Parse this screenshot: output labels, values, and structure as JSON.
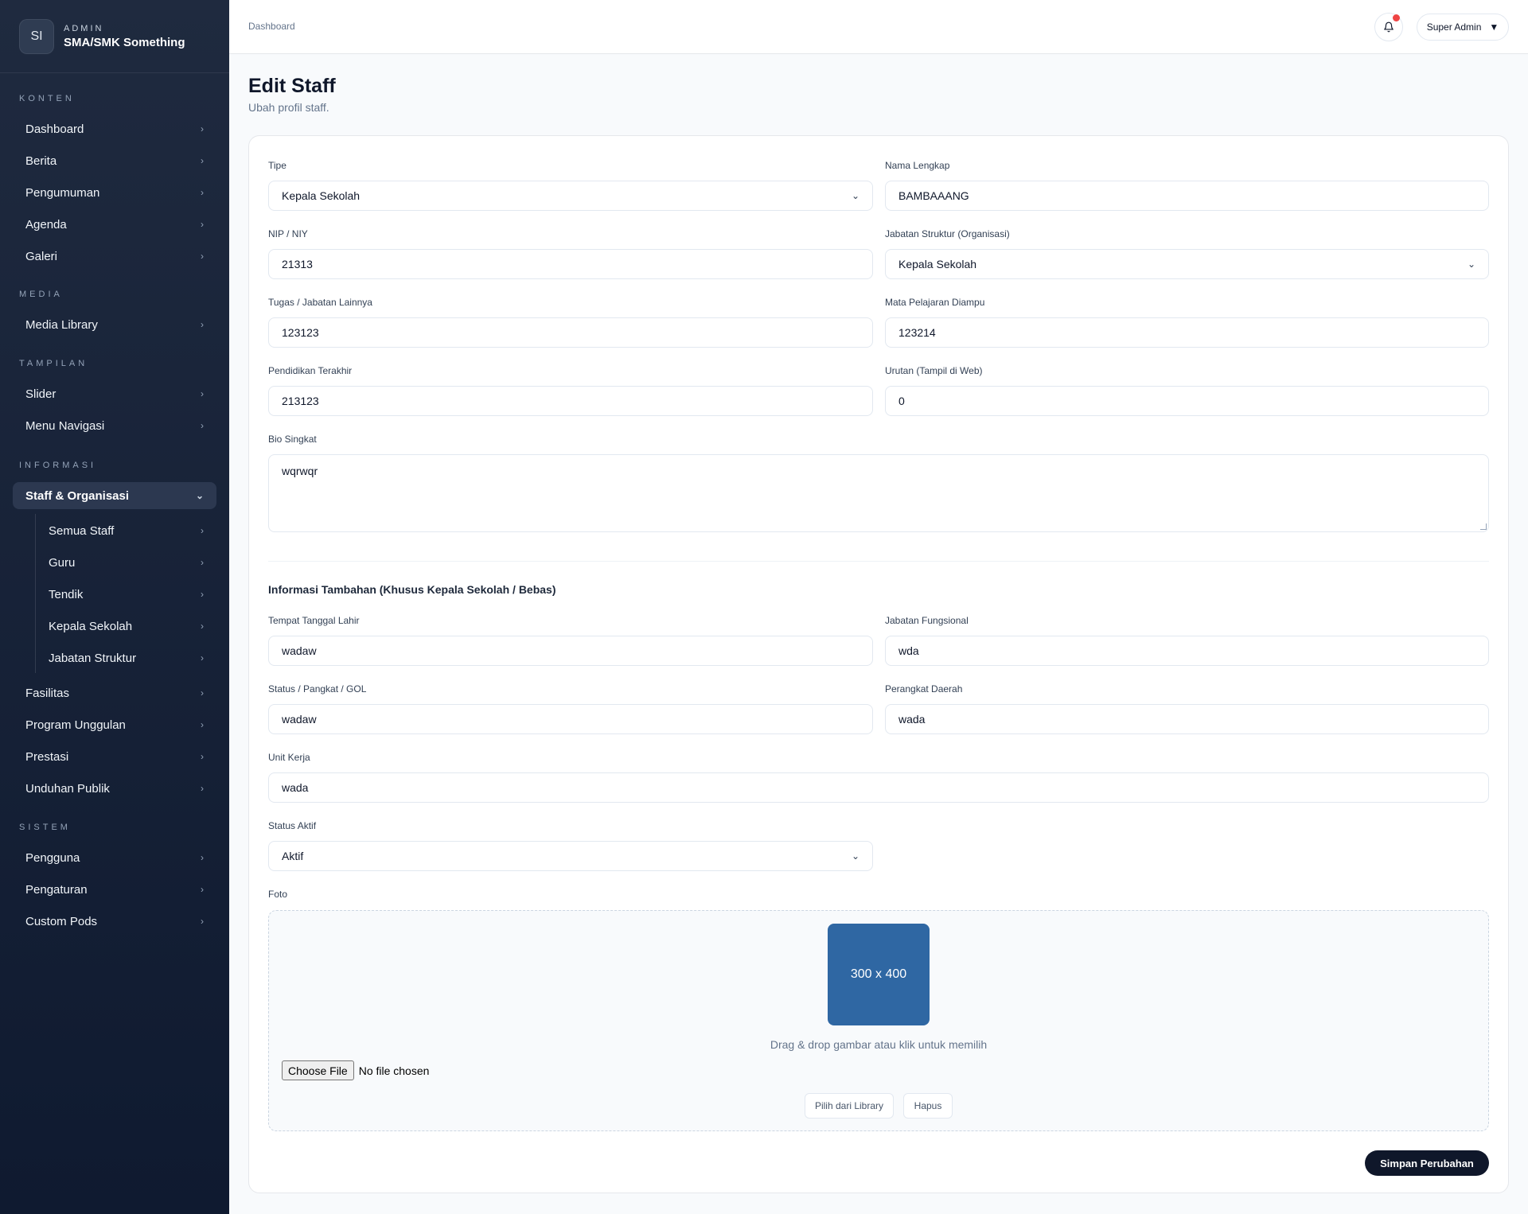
{
  "brand": {
    "initials": "SI",
    "kicker": "ADMIN",
    "name": "SMA/SMK Something"
  },
  "sidebar": {
    "sections": {
      "konten": "KONTEN",
      "media": "MEDIA",
      "tampilan": "TAMPILAN",
      "informasi": "INFORMASI",
      "sistem": "SISTEM"
    },
    "items": {
      "dashboard": "Dashboard",
      "berita": "Berita",
      "pengumuman": "Pengumuman",
      "agenda": "Agenda",
      "galeri": "Galeri",
      "media_library": "Media Library",
      "slider": "Slider",
      "menu_navigasi": "Menu Navigasi",
      "staff_organisasi": "Staff & Organisasi",
      "semua_staff": "Semua Staff",
      "guru": "Guru",
      "tendik": "Tendik",
      "kepala_sekolah": "Kepala Sekolah",
      "jabatan_struktur": "Jabatan Struktur",
      "fasilitas": "Fasilitas",
      "program_unggulan": "Program Unggulan",
      "prestasi": "Prestasi",
      "unduhan_publik": "Unduhan Publik",
      "pengguna": "Pengguna",
      "pengaturan": "Pengaturan",
      "custom_pods": "Custom Pods"
    }
  },
  "topbar": {
    "breadcrumb": "Dashboard",
    "user": "Super Admin"
  },
  "page": {
    "title": "Edit Staff",
    "subtitle": "Ubah profil staff."
  },
  "form": {
    "tipe": {
      "label": "Tipe",
      "value": "Kepala Sekolah"
    },
    "nama": {
      "label": "Nama Lengkap",
      "value": "BAMBAAANG"
    },
    "nip": {
      "label": "NIP / NIY",
      "value": "21313"
    },
    "jabatan_struktur": {
      "label": "Jabatan Struktur (Organisasi)",
      "value": "Kepala Sekolah"
    },
    "tugas": {
      "label": "Tugas / Jabatan Lainnya",
      "value": "123123"
    },
    "mapel": {
      "label": "Mata Pelajaran Diampu",
      "value": "123214"
    },
    "pendidikan": {
      "label": "Pendidikan Terakhir",
      "value": "213123"
    },
    "urutan": {
      "label": "Urutan (Tampil di Web)",
      "value": "0"
    },
    "bio": {
      "label": "Bio Singkat",
      "value": "wqrwqr"
    },
    "extra_heading": "Informasi Tambahan (Khusus Kepala Sekolah / Bebas)",
    "ttl": {
      "label": "Tempat Tanggal Lahir",
      "value": "wadaw"
    },
    "jabatan_fungsional": {
      "label": "Jabatan Fungsional",
      "value": "wda"
    },
    "status_pangkat": {
      "label": "Status / Pangkat / GOL",
      "value": "wadaw"
    },
    "perangkat_daerah": {
      "label": "Perangkat Daerah",
      "value": "wada"
    },
    "unit_kerja": {
      "label": "Unit Kerja",
      "value": "wada"
    },
    "status_aktif": {
      "label": "Status Aktif",
      "value": "Aktif"
    },
    "foto": {
      "label": "Foto",
      "placeholder_text": "300 x 400",
      "hint": "Drag & drop gambar atau klik untuk memilih",
      "choose_file": "Choose File",
      "no_file": "No file chosen",
      "library_btn": "Pilih dari Library",
      "remove_btn": "Hapus"
    },
    "save": "Simpan Perubahan"
  }
}
